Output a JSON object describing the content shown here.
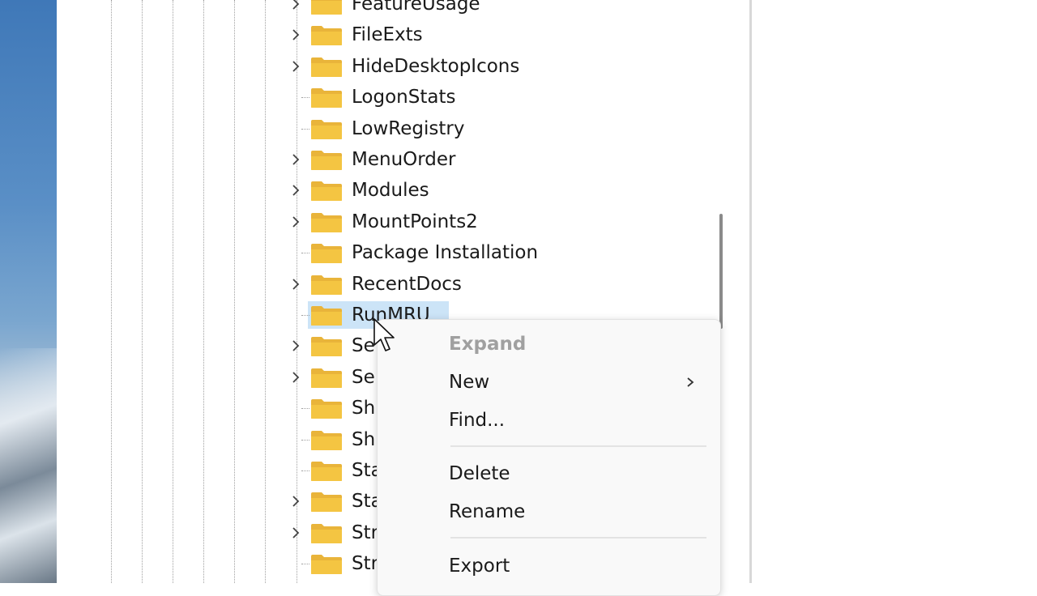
{
  "tree": {
    "items": [
      {
        "label": "FeatureUsage",
        "expandable": true
      },
      {
        "label": "FileExts",
        "expandable": true
      },
      {
        "label": "HideDesktopIcons",
        "expandable": true
      },
      {
        "label": "LogonStats",
        "expandable": false
      },
      {
        "label": "LowRegistry",
        "expandable": false
      },
      {
        "label": "MenuOrder",
        "expandable": true
      },
      {
        "label": "Modules",
        "expandable": true
      },
      {
        "label": "MountPoints2",
        "expandable": true
      },
      {
        "label": "Package Installation",
        "expandable": false
      },
      {
        "label": "RecentDocs",
        "expandable": true
      },
      {
        "label": "RunMRU",
        "expandable": false,
        "selected": true
      },
      {
        "label": "Se",
        "expandable": true
      },
      {
        "label": "Se",
        "expandable": true
      },
      {
        "label": "Sh",
        "expandable": false
      },
      {
        "label": "Sh",
        "expandable": false
      },
      {
        "label": "Sta",
        "expandable": false
      },
      {
        "label": "Sta",
        "expandable": true
      },
      {
        "label": "Str",
        "expandable": true
      },
      {
        "label": "Str",
        "expandable": false
      }
    ]
  },
  "context_menu": {
    "expand": "Expand",
    "new": "New",
    "find": "Find...",
    "delete": "Delete",
    "rename": "Rename",
    "export": "Export"
  },
  "colors": {
    "folder": "#f4c542",
    "selection": "#cce4f7",
    "disabled_text": "#a0a0a0"
  }
}
